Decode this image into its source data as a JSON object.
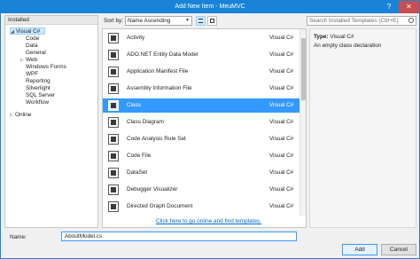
{
  "window": {
    "title": "Add New Item - MeuMVC",
    "help_label": "?",
    "close_label": "✕"
  },
  "tree": {
    "header": "Installed",
    "items": [
      {
        "label": "Visual C#",
        "arrow": "◢"
      },
      {
        "label": "Code"
      },
      {
        "label": "Data"
      },
      {
        "label": "General"
      },
      {
        "label": "Web",
        "arrow": "▷"
      },
      {
        "label": "Windows Forms"
      },
      {
        "label": "WPF"
      },
      {
        "label": "Reporting"
      },
      {
        "label": "Silverlight"
      },
      {
        "label": "SQL Server"
      },
      {
        "label": "Workflow"
      }
    ],
    "online": {
      "label": "Online",
      "arrow": "▷"
    }
  },
  "toolbar": {
    "sort_label": "Sort by:",
    "sort_value": "Name Ascending",
    "search_placeholder": "Search Installed Templates (Ctrl+E)"
  },
  "templates": [
    {
      "name": "Activity",
      "lang": "Visual C#",
      "icon": "activity-icon"
    },
    {
      "name": "ADO.NET Entity Data Model",
      "lang": "Visual C#",
      "icon": "entity-model-icon"
    },
    {
      "name": "Application Manifest File",
      "lang": "Visual C#",
      "icon": "manifest-icon"
    },
    {
      "name": "Assembly Information File",
      "lang": "Visual C#",
      "icon": "assembly-info-icon"
    },
    {
      "name": "Class",
      "lang": "Visual C#",
      "icon": "class-icon",
      "selected": true
    },
    {
      "name": "Class Diagram",
      "lang": "Visual C#",
      "icon": "class-diagram-icon"
    },
    {
      "name": "Code Analysis Rule Set",
      "lang": "Visual C#",
      "icon": "rule-set-icon"
    },
    {
      "name": "Code File",
      "lang": "Visual C#",
      "icon": "code-file-icon"
    },
    {
      "name": "DataSet",
      "lang": "Visual C#",
      "icon": "dataset-icon"
    },
    {
      "name": "Debugger Visualizer",
      "lang": "Visual C#",
      "icon": "debugger-visualizer-icon"
    },
    {
      "name": "Directed Graph Document",
      "lang": "Visual C#",
      "icon": "directed-graph-icon"
    }
  ],
  "online_link": "Click here to go online and find templates.",
  "details": {
    "type_label": "Type:",
    "type_value": "Visual C#",
    "description": "An empty class declaration"
  },
  "bottom": {
    "name_label": "Name:",
    "name_value": "AboutModel.cs",
    "add_label": "Add",
    "cancel_label": "Cancel"
  },
  "colors": {
    "accent": "#1883d7",
    "selection": "#3399ff"
  }
}
